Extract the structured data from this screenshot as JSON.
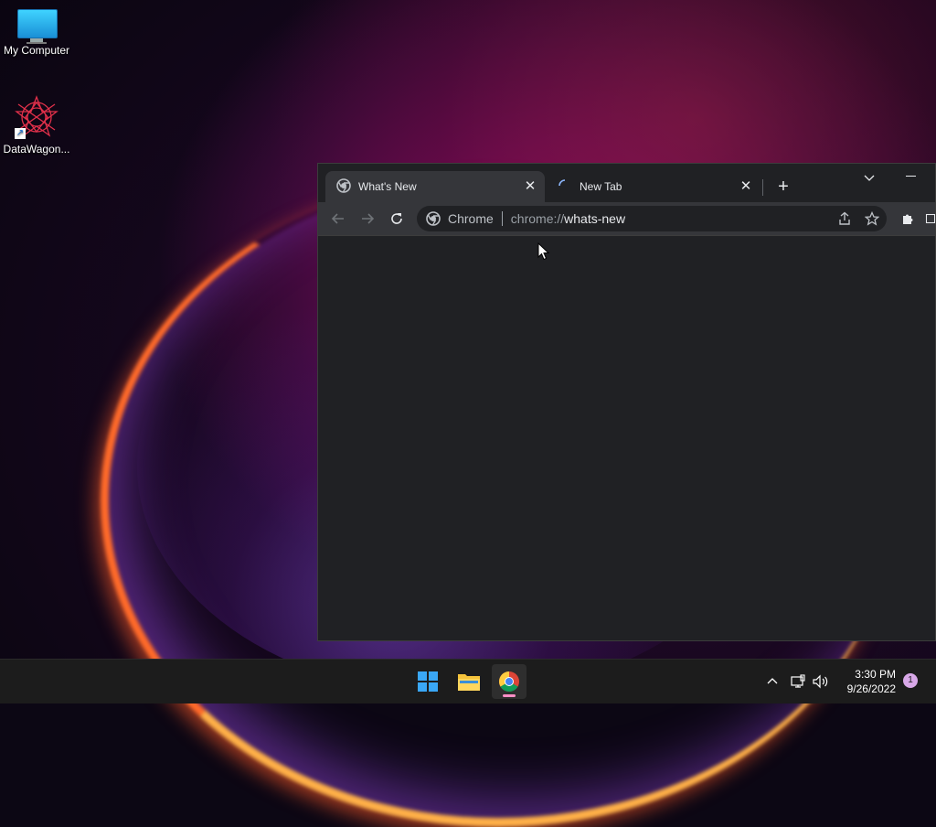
{
  "desktop": {
    "icons": [
      {
        "label": "My Computer"
      },
      {
        "label": "DataWagon..."
      }
    ]
  },
  "browser": {
    "tabs": [
      {
        "title": "What's New",
        "active": true
      },
      {
        "title": "New Tab",
        "active": false
      }
    ],
    "omnibox": {
      "chip_label": "Chrome",
      "url_scheme": "chrome://",
      "url_host": "whats-new"
    }
  },
  "taskbar": {
    "apps": [
      "start-icon",
      "file-explorer-icon",
      "chrome-icon"
    ],
    "clock": {
      "time": "3:30 PM",
      "date": "9/26/2022"
    },
    "notification_count": "1"
  }
}
